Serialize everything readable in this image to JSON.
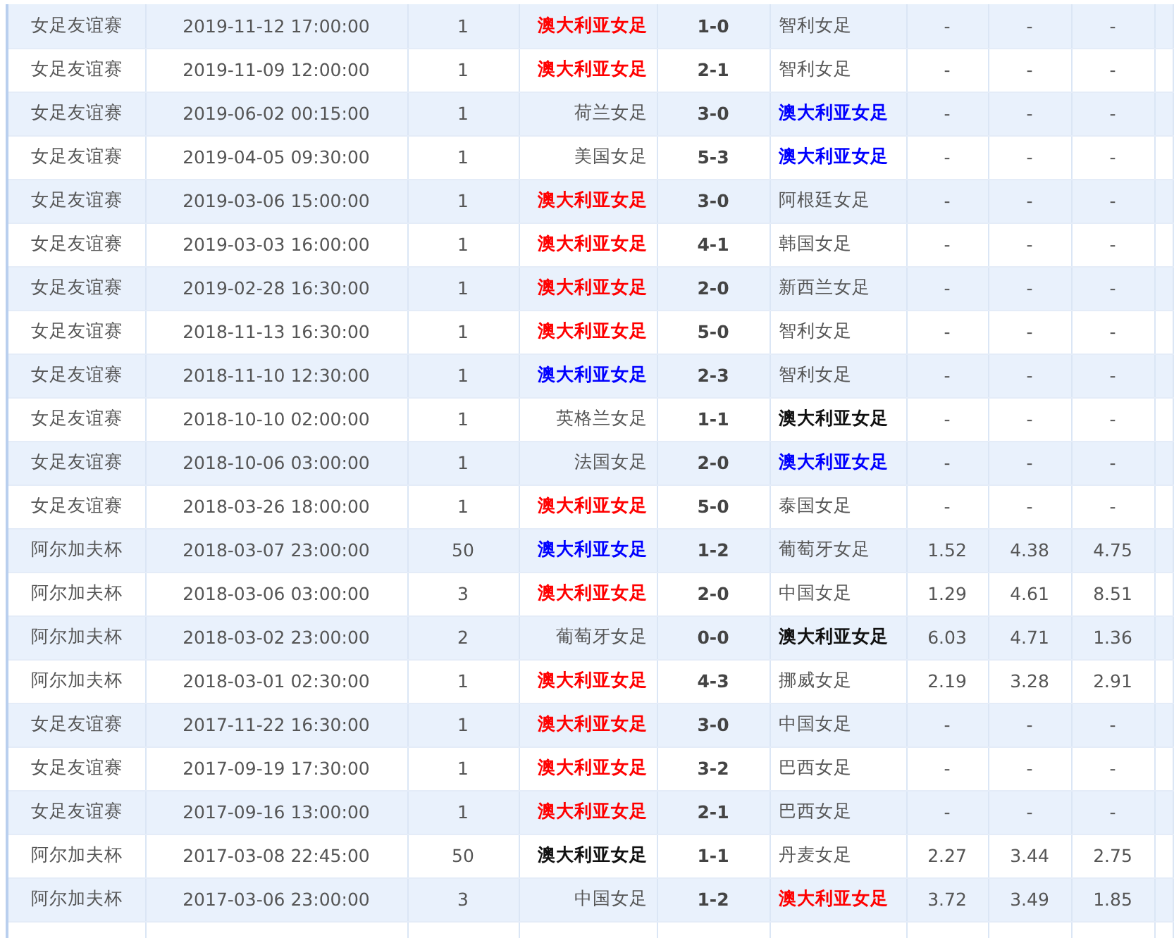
{
  "matches": [
    {
      "league": "女足友谊赛",
      "time": "2019-11-12 17:00:00",
      "column_3": "1",
      "home": {
        "name": "澳大利亚女足",
        "color": "#ff0000"
      },
      "score": "1-0",
      "away": {
        "name": "智利女足"
      },
      "odds": [
        "-",
        "-",
        "-"
      ]
    },
    {
      "league": "女足友谊赛",
      "time": "2019-11-09 12:00:00",
      "column_3": "1",
      "home": {
        "name": "澳大利亚女足",
        "color": "#ff0000"
      },
      "score": "2-1",
      "away": {
        "name": "智利女足"
      },
      "odds": [
        "-",
        "-",
        "-"
      ]
    },
    {
      "league": "女足友谊赛",
      "time": "2019-06-02 00:15:00",
      "column_3": "1",
      "home": {
        "name": "荷兰女足"
      },
      "score": "3-0",
      "away": {
        "name": "澳大利亚女足",
        "color": "#0000ff"
      },
      "odds": [
        "-",
        "-",
        "-"
      ]
    },
    {
      "league": "女足友谊赛",
      "time": "2019-04-05 09:30:00",
      "column_3": "1",
      "home": {
        "name": "美国女足"
      },
      "score": "5-3",
      "away": {
        "name": "澳大利亚女足",
        "color": "#0000ff"
      },
      "odds": [
        "-",
        "-",
        "-"
      ]
    },
    {
      "league": "女足友谊赛",
      "time": "2019-03-06 15:00:00",
      "column_3": "1",
      "home": {
        "name": "澳大利亚女足",
        "color": "#ff0000"
      },
      "score": "3-0",
      "away": {
        "name": "阿根廷女足"
      },
      "odds": [
        "-",
        "-",
        "-"
      ]
    },
    {
      "league": "女足友谊赛",
      "time": "2019-03-03 16:00:00",
      "column_3": "1",
      "home": {
        "name": "澳大利亚女足",
        "color": "#ff0000"
      },
      "score": "4-1",
      "away": {
        "name": "韩国女足"
      },
      "odds": [
        "-",
        "-",
        "-"
      ]
    },
    {
      "league": "女足友谊赛",
      "time": "2019-02-28 16:30:00",
      "column_3": "1",
      "home": {
        "name": "澳大利亚女足",
        "color": "#ff0000"
      },
      "score": "2-0",
      "away": {
        "name": "新西兰女足"
      },
      "odds": [
        "-",
        "-",
        "-"
      ]
    },
    {
      "league": "女足友谊赛",
      "time": "2018-11-13 16:30:00",
      "column_3": "1",
      "home": {
        "name": "澳大利亚女足",
        "color": "#ff0000"
      },
      "score": "5-0",
      "away": {
        "name": "智利女足"
      },
      "odds": [
        "-",
        "-",
        "-"
      ]
    },
    {
      "league": "女足友谊赛",
      "time": "2018-11-10 12:30:00",
      "column_3": "1",
      "home": {
        "name": "澳大利亚女足",
        "color": "#0000ff"
      },
      "score": "2-3",
      "away": {
        "name": "智利女足"
      },
      "odds": [
        "-",
        "-",
        "-"
      ]
    },
    {
      "league": "女足友谊赛",
      "time": "2018-10-10 02:00:00",
      "column_3": "1",
      "home": {
        "name": "英格兰女足"
      },
      "score": "1-1",
      "away": {
        "name": "澳大利亚女足",
        "color": "#111111"
      },
      "odds": [
        "-",
        "-",
        "-"
      ]
    },
    {
      "league": "女足友谊赛",
      "time": "2018-10-06 03:00:00",
      "column_3": "1",
      "home": {
        "name": "法国女足"
      },
      "score": "2-0",
      "away": {
        "name": "澳大利亚女足",
        "color": "#0000ff"
      },
      "odds": [
        "-",
        "-",
        "-"
      ]
    },
    {
      "league": "女足友谊赛",
      "time": "2018-03-26 18:00:00",
      "column_3": "1",
      "home": {
        "name": "澳大利亚女足",
        "color": "#ff0000"
      },
      "score": "5-0",
      "away": {
        "name": "泰国女足"
      },
      "odds": [
        "-",
        "-",
        "-"
      ]
    },
    {
      "league": "阿尔加夫杯",
      "time": "2018-03-07 23:00:00",
      "column_3": "50",
      "home": {
        "name": "澳大利亚女足",
        "color": "#0000ff"
      },
      "score": "1-2",
      "away": {
        "name": "葡萄牙女足"
      },
      "odds": [
        "1.52",
        "4.38",
        "4.75"
      ]
    },
    {
      "league": "阿尔加夫杯",
      "time": "2018-03-06 03:00:00",
      "column_3": "3",
      "home": {
        "name": "澳大利亚女足",
        "color": "#ff0000"
      },
      "score": "2-0",
      "away": {
        "name": "中国女足"
      },
      "odds": [
        "1.29",
        "4.61",
        "8.51"
      ]
    },
    {
      "league": "阿尔加夫杯",
      "time": "2018-03-02 23:00:00",
      "column_3": "2",
      "home": {
        "name": "葡萄牙女足"
      },
      "score": "0-0",
      "away": {
        "name": "澳大利亚女足",
        "color": "#111111"
      },
      "odds": [
        "6.03",
        "4.71",
        "1.36"
      ]
    },
    {
      "league": "阿尔加夫杯",
      "time": "2018-03-01 02:30:00",
      "column_3": "1",
      "home": {
        "name": "澳大利亚女足",
        "color": "#ff0000"
      },
      "score": "4-3",
      "away": {
        "name": "挪威女足"
      },
      "odds": [
        "2.19",
        "3.28",
        "2.91"
      ]
    },
    {
      "league": "女足友谊赛",
      "time": "2017-11-22 16:30:00",
      "column_3": "1",
      "home": {
        "name": "澳大利亚女足",
        "color": "#ff0000"
      },
      "score": "3-0",
      "away": {
        "name": "中国女足"
      },
      "odds": [
        "-",
        "-",
        "-"
      ]
    },
    {
      "league": "女足友谊赛",
      "time": "2017-09-19 17:30:00",
      "column_3": "1",
      "home": {
        "name": "澳大利亚女足",
        "color": "#ff0000"
      },
      "score": "3-2",
      "away": {
        "name": "巴西女足"
      },
      "odds": [
        "-",
        "-",
        "-"
      ]
    },
    {
      "league": "女足友谊赛",
      "time": "2017-09-16 13:00:00",
      "column_3": "1",
      "home": {
        "name": "澳大利亚女足",
        "color": "#ff0000"
      },
      "score": "2-1",
      "away": {
        "name": "巴西女足"
      },
      "odds": [
        "-",
        "-",
        "-"
      ]
    },
    {
      "league": "阿尔加夫杯",
      "time": "2017-03-08 22:45:00",
      "column_3": "50",
      "home": {
        "name": "澳大利亚女足",
        "color": "#111111"
      },
      "score": "1-1",
      "away": {
        "name": "丹麦女足"
      },
      "odds": [
        "2.27",
        "3.44",
        "2.75"
      ]
    },
    {
      "league": "阿尔加夫杯",
      "time": "2017-03-06 23:00:00",
      "column_3": "3",
      "home": {
        "name": "中国女足"
      },
      "score": "1-2",
      "away": {
        "name": "澳大利亚女足",
        "color": "#ff0000"
      },
      "odds": [
        "3.72",
        "3.49",
        "1.85"
      ]
    }
  ]
}
